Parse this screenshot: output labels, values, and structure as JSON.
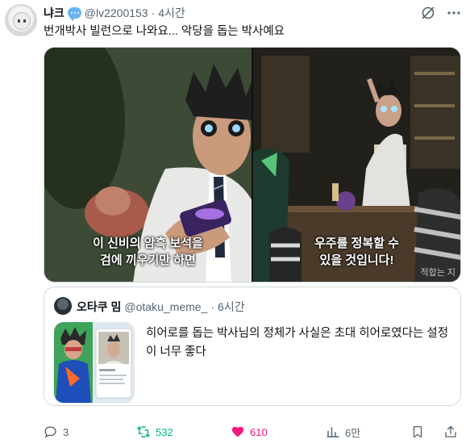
{
  "tweet": {
    "display_name": "냐크",
    "handle": "@lv2200153",
    "separator": "·",
    "time": "4시간",
    "text": "번개박사 빌런으로 나와요... 악당을 돕는 박사예요",
    "media": {
      "left_subtitle_line1": "이 신비의 암흑 보석을",
      "left_subtitle_line2": "검에 끼우기만 하면",
      "right_subtitle_line1": "우주를 정복할 수",
      "right_subtitle_line2": "있을 것입니다!",
      "right_corner_text": "적합는 지"
    },
    "quote": {
      "display_name": "오타쿠 밈",
      "handle": "@otaku_meme_",
      "separator": "·",
      "time": "6시간",
      "text": "히어로를 돕는 박사님의 정체가 사실은 초대 히어로였다는 설정이 너무 좋다"
    },
    "actions": {
      "reply_count": "3",
      "retweet_count": "532",
      "like_count": "610",
      "views_count": "6만"
    }
  },
  "colors": {
    "accent_like": "#f91880",
    "accent_retweet": "#00ba7c",
    "secondary_text": "#536471",
    "border": "#cfd9de"
  },
  "icons": [
    "grok-icon",
    "more-icon",
    "verified-bubble-icon",
    "reply-icon",
    "retweet-icon",
    "like-icon",
    "views-icon",
    "bookmark-icon",
    "share-icon"
  ]
}
